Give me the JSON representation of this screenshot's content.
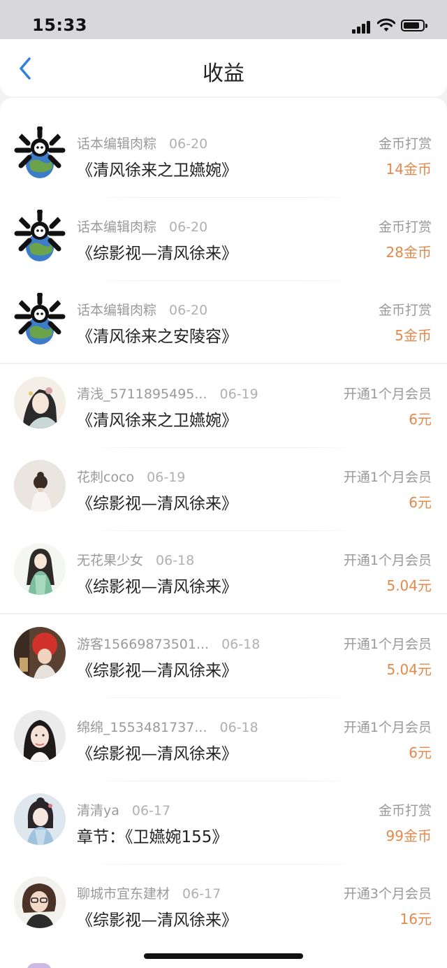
{
  "status_bar": {
    "time": "15:33"
  },
  "header": {
    "title": "收益"
  },
  "rows": [
    {
      "name": "话本编辑肉粽",
      "date": "06-20",
      "work": "《清风徐来之卫嬿婉》",
      "type": "金币打赏",
      "amount": "14金币",
      "avatar": "panda-avatar"
    },
    {
      "name": "话本编辑肉粽",
      "date": "06-20",
      "work": "《综影视—清风徐来》",
      "type": "金币打赏",
      "amount": "28金币",
      "avatar": "panda-avatar"
    },
    {
      "name": "话本编辑肉粽",
      "date": "06-20",
      "work": "《清风徐来之安陵容》",
      "type": "金币打赏",
      "amount": "5金币",
      "avatar": "panda-avatar"
    },
    {
      "name": "清浅_5711895495...",
      "date": "06-19",
      "work": "《清风徐来之卫嬿婉》",
      "type": "开通1个月会员",
      "amount": "6元",
      "avatar": "ancient-lady-avatar"
    },
    {
      "name": "花刺coco",
      "date": "06-19",
      "work": "《综影视—清风徐来》",
      "type": "开通1个月会员",
      "amount": "6元",
      "avatar": "girl-back-avatar"
    },
    {
      "name": "无花果少女",
      "date": "06-18",
      "work": "《综影视—清风徐来》",
      "type": "开通1个月会员",
      "amount": "5.04元",
      "avatar": "green-dress-avatar"
    },
    {
      "name": "游客15669873501...",
      "date": "06-18",
      "work": "《综影视—清风徐来》",
      "type": "开通1个月会员",
      "amount": "5.04元",
      "avatar": "red-hat-avatar"
    },
    {
      "name": "绵绵_1553481737...",
      "date": "06-18",
      "work": "《综影视—清风徐来》",
      "type": "开通1个月会员",
      "amount": "6元",
      "avatar": "girl-portrait-avatar"
    },
    {
      "name": "清清ya",
      "date": "06-17",
      "work": "章节：《卫嬿婉155》",
      "type": "金币打赏",
      "amount": "99金币",
      "avatar": "painted-lady-avatar"
    },
    {
      "name": "聊城市宜东建材",
      "date": "06-17",
      "work": "《综影视—清风徐来》",
      "type": "开通3个月会员",
      "amount": "16元",
      "avatar": "woman-glasses-avatar"
    }
  ],
  "colors": {
    "accent": "#2f80e0",
    "amount": "#e2894b",
    "background": "#f2f2f4"
  }
}
